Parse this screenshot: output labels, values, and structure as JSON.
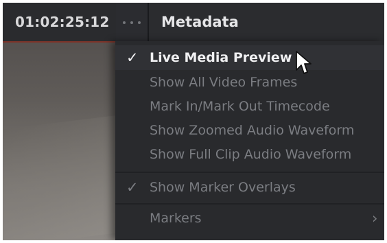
{
  "header": {
    "timecode": "01:02:25:12",
    "more_icon": "three-dots-icon",
    "metadata_tab": "Metadata"
  },
  "menu": {
    "items": [
      {
        "label": "Live Media Preview",
        "checked": true,
        "highlighted": true,
        "enabled": true
      },
      {
        "label": "Show All Video Frames",
        "checked": false,
        "highlighted": false,
        "enabled": false
      },
      {
        "label": "Mark In/Mark Out Timecode",
        "checked": false,
        "highlighted": false,
        "enabled": false
      },
      {
        "label": "Show Zoomed Audio Waveform",
        "checked": false,
        "highlighted": false,
        "enabled": false
      },
      {
        "label": "Show Full Clip Audio Waveform",
        "checked": false,
        "highlighted": false,
        "enabled": false
      },
      {
        "label": "Show Marker Overlays",
        "checked": true,
        "highlighted": false,
        "enabled": false
      },
      {
        "label": "Markers",
        "checked": false,
        "highlighted": false,
        "enabled": false,
        "has_submenu": true
      }
    ],
    "check_glyph": "✓",
    "submenu_arrow": "›"
  },
  "colors": {
    "panel_background": "#2a2b2e",
    "menu_background": "#292a2d",
    "highlight_background": "#303135",
    "active_text": "#f0f0f2",
    "inactive_text": "#7b7d82",
    "viewer_accent": "#7d3329"
  },
  "icons": {
    "cursor": "mouse-pointer-icon",
    "checkmark": "checkmark-icon",
    "submenu": "chevron-right-icon"
  }
}
